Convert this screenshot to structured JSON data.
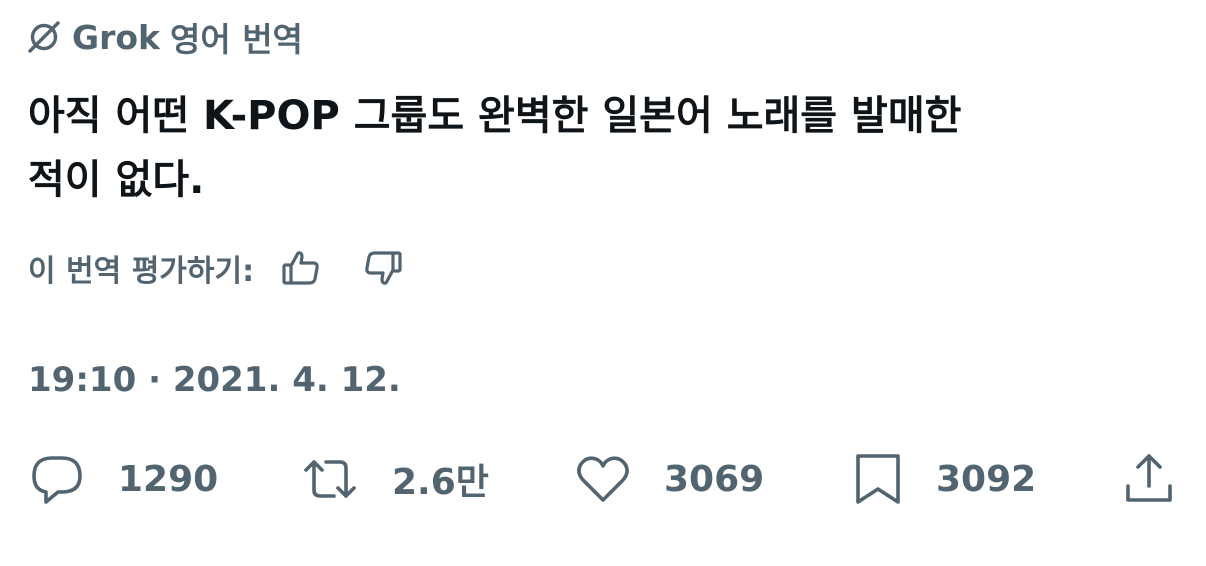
{
  "translation": {
    "provider": "Grok",
    "label": "영어 번역"
  },
  "tweet": {
    "line1": "아직 어떤 K-POP 그룹도 완벽한 일본어 노래를 발매한",
    "line2": "적이 없다.",
    "timestamp": "19:10 · 2021. 4. 12."
  },
  "rating": {
    "label": "이 번역 평가하기:",
    "up_icon": "thumbs-up-icon",
    "down_icon": "thumbs-down-icon"
  },
  "actions": {
    "reply_count": "1290",
    "retweet_count": "2.6만",
    "like_count": "3069",
    "bookmark_count": "3092",
    "icons": [
      "reply-icon",
      "retweet-icon",
      "like-icon",
      "bookmark-icon",
      "share-icon"
    ]
  },
  "colors": {
    "primary_text": "#0f1419",
    "secondary_text": "#536471",
    "background": "#ffffff"
  }
}
